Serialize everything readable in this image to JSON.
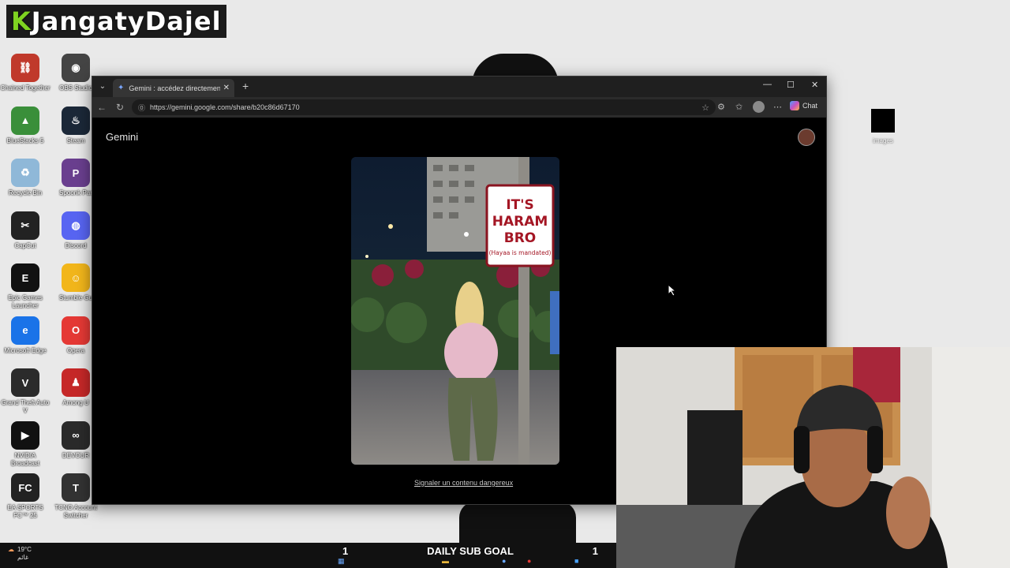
{
  "channel": {
    "logo_first_letter": "K",
    "logo_rest": "JangatyDajel"
  },
  "desktop_icons": [
    {
      "label": "Chained Together",
      "name": "chained-together-icon"
    },
    {
      "label": "OBS Studio",
      "name": "obs-studio-icon"
    },
    {
      "label": "BlueStacks 5",
      "name": "bluestacks-icon"
    },
    {
      "label": "Steam",
      "name": "steam-icon"
    },
    {
      "label": "Recycle Bin",
      "name": "recycle-bin-icon"
    },
    {
      "label": "Spoonk Par",
      "name": "party-game-icon"
    },
    {
      "label": "CapCut",
      "name": "capcut-icon"
    },
    {
      "label": "Discord",
      "name": "discord-icon"
    },
    {
      "label": "Epic Games Launcher",
      "name": "epic-games-icon"
    },
    {
      "label": "Stumble Gu",
      "name": "stumble-guys-icon"
    },
    {
      "label": "Microsoft Edge",
      "name": "edge-icon"
    },
    {
      "label": "Opera",
      "name": "opera-icon"
    },
    {
      "label": "Grand Theft Auto V",
      "name": "gta-v-icon"
    },
    {
      "label": "Among U",
      "name": "among-us-icon"
    },
    {
      "label": "NVIDIA Broadcast",
      "name": "nvidia-broadcast-icon"
    },
    {
      "label": "DEVOUR",
      "name": "devour-icon"
    },
    {
      "label": "EA SPORTS FC™ 25",
      "name": "ea-fc-icon"
    },
    {
      "label": "TCNO Account Switcher",
      "name": "tcno-icon"
    }
  ],
  "browser": {
    "tab_title": "Gemini : accédez directement à l'IA",
    "url": "https://gemini.google.com/share/b20c86d67170",
    "chat_label": "Chat"
  },
  "page": {
    "app_name": "Gemini",
    "sign": {
      "line1": "IT'S",
      "line2": "HARAM",
      "line3": "BRO",
      "line4": "(Hayaa is mandated)"
    },
    "report_link": "Signaler un contenu dangereux"
  },
  "desktop_right_icon": {
    "label": "images"
  },
  "taskbar": {
    "weather_temp": "19°C",
    "weather_text": "غائم",
    "sub_goal_left": "1",
    "sub_goal_title": "DAILY SUB GOAL",
    "sub_goal_right": "1"
  },
  "colors": {
    "desktop_bg": "#e9e9e9",
    "browser_bg": "#000000",
    "accent_green": "#7fd321"
  }
}
